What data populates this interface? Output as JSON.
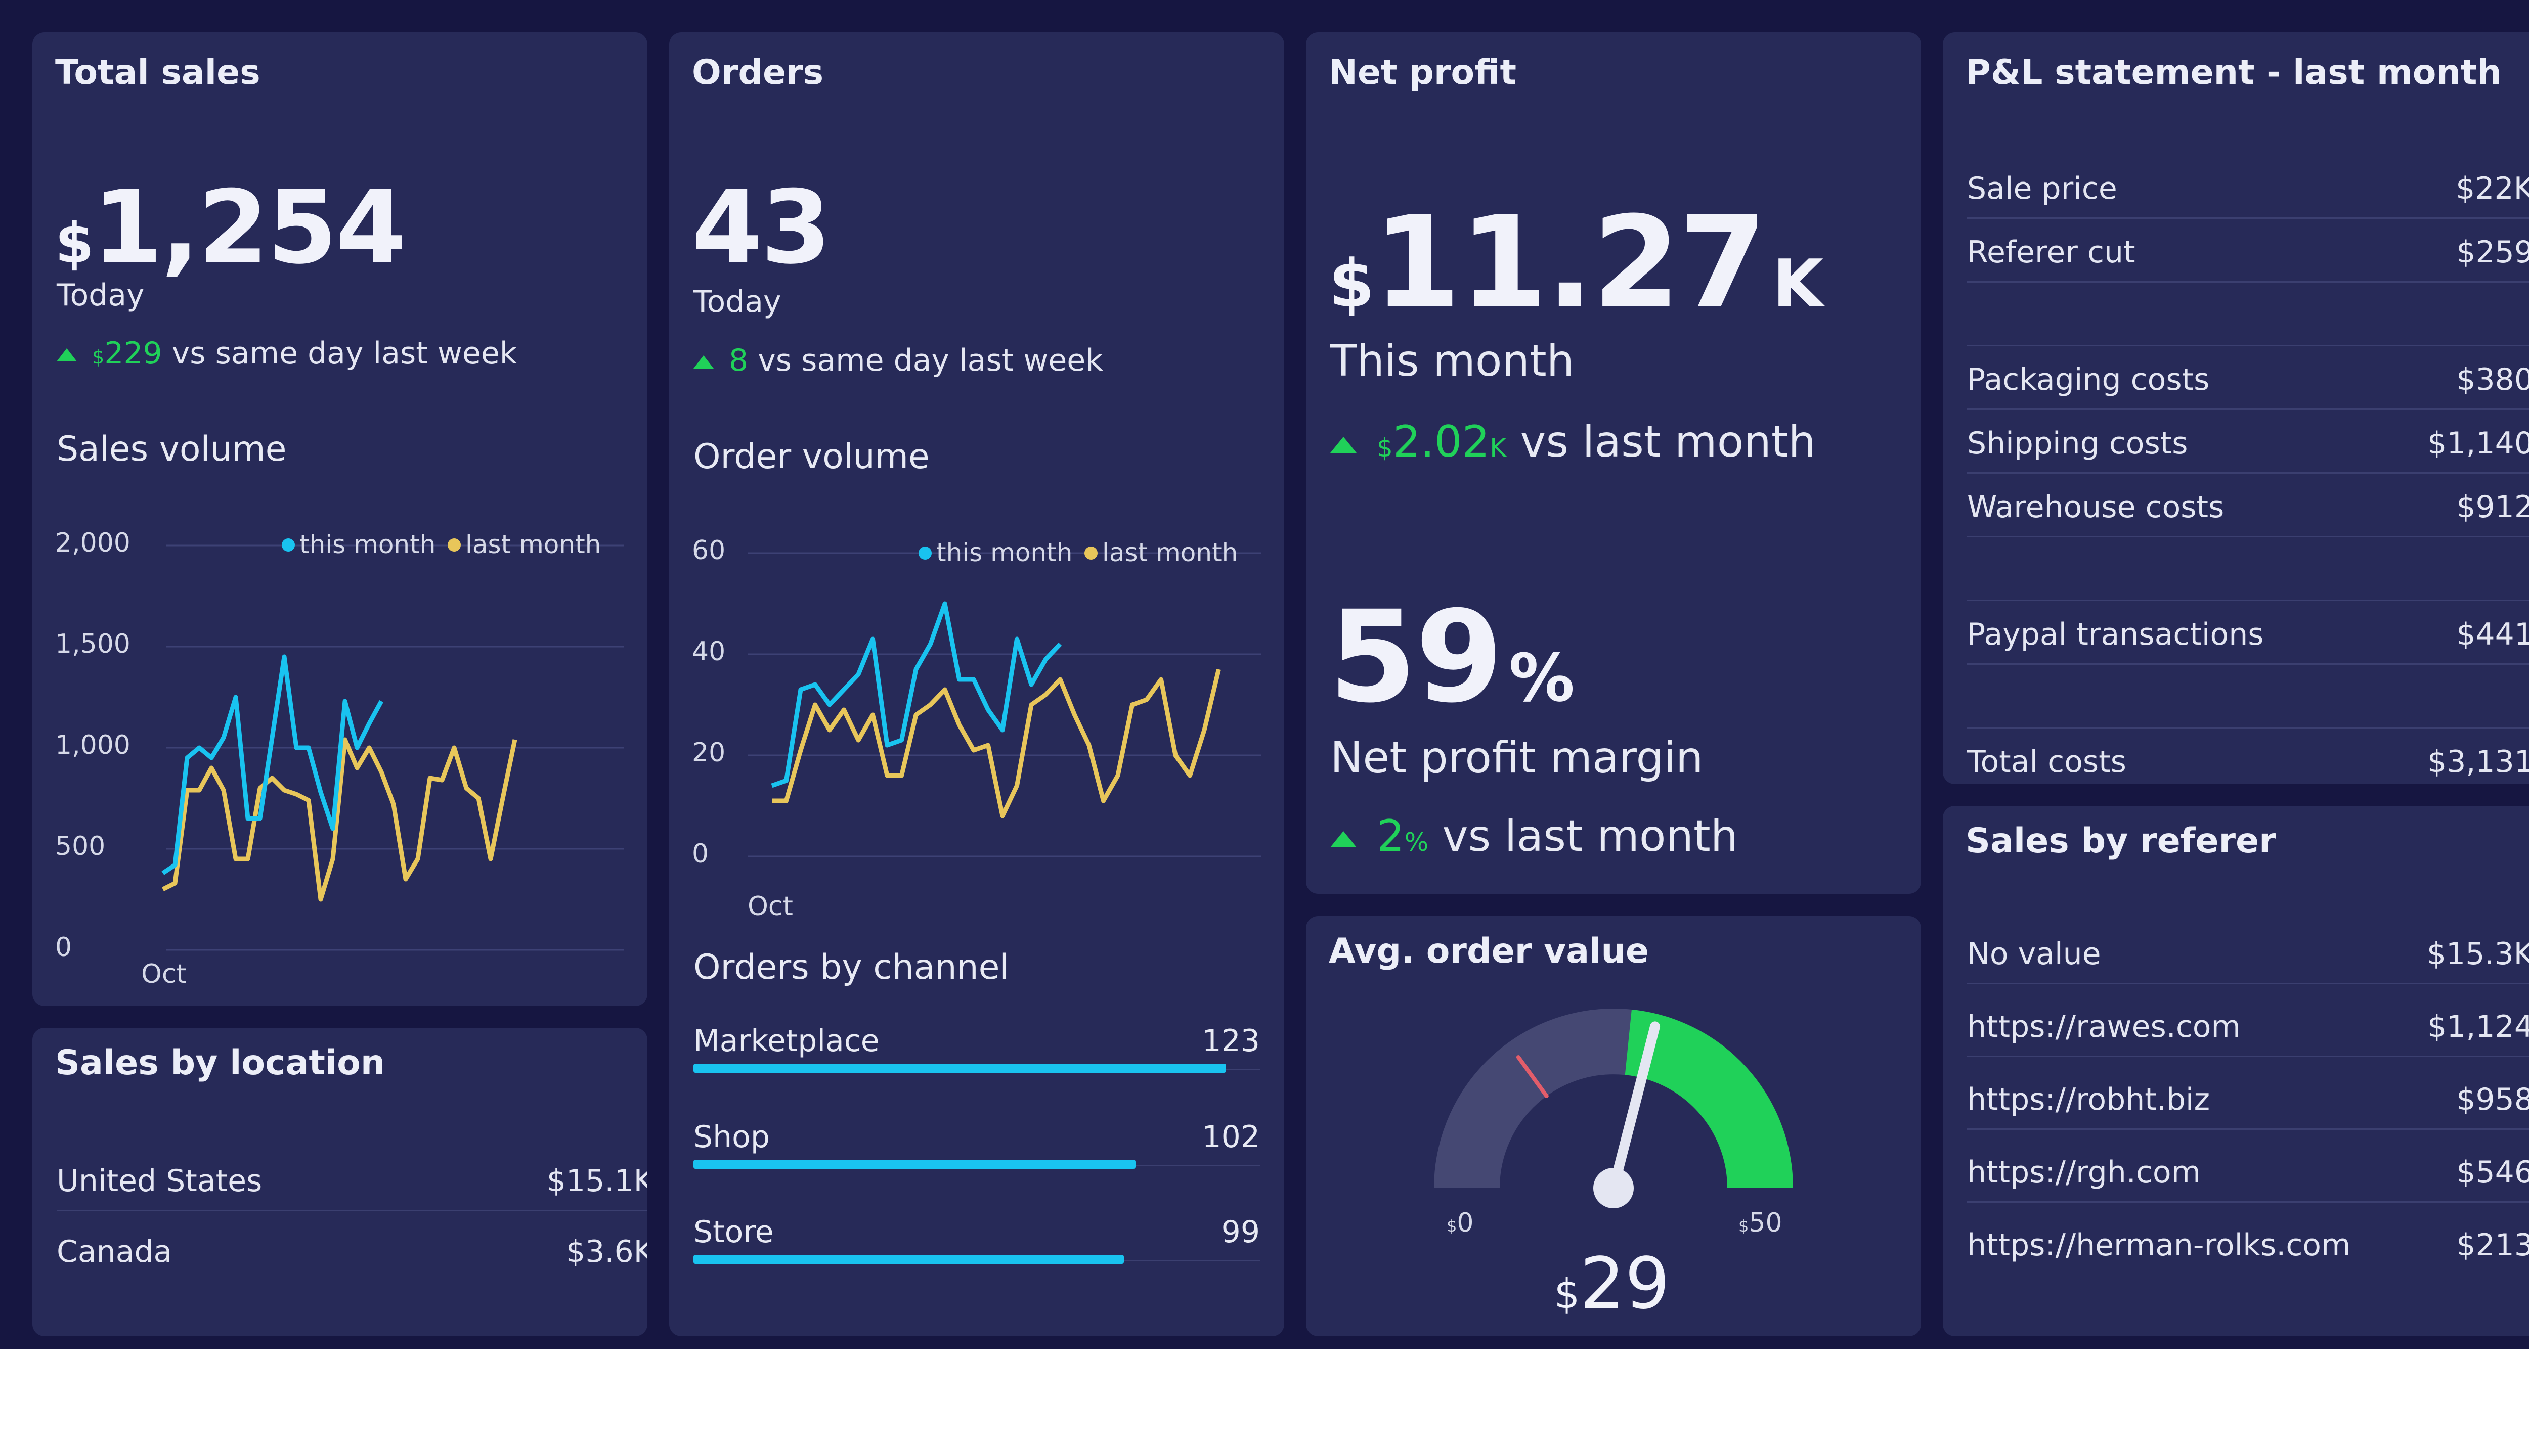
{
  "colors": {
    "background": "#161641",
    "panel": "#272a58",
    "this_month": "#19c3f0",
    "last_month": "#e8c65a",
    "positive": "#20d159",
    "bar": "#19c3f0",
    "gauge_track": "#454873",
    "gauge_needle": "#e4e6f2",
    "gauge_marker": "#e35d6a"
  },
  "total_sales": {
    "title": "Total sales",
    "currency": "$",
    "value": "1,254",
    "period": "Today",
    "change_currency": "$",
    "change_value": "229",
    "change_text": "vs same day last week",
    "chart_title": "Sales volume"
  },
  "orders": {
    "title": "Orders",
    "value": "43",
    "period": "Today",
    "change_value": "8",
    "change_text": "vs same day last week",
    "chart_title": "Order volume",
    "channels_title": "Orders by channel",
    "channels": [
      {
        "name": "Marketplace",
        "value": "123",
        "fraction": 0.94
      },
      {
        "name": "Shop",
        "value": "102",
        "fraction": 0.78
      },
      {
        "name": "Store",
        "value": "99",
        "fraction": 0.76
      }
    ]
  },
  "net_profit": {
    "title": "Net profit",
    "currency": "$",
    "value": "11.27",
    "unit": "K",
    "period": "This month",
    "change_currency": "$",
    "change_value": "2.02",
    "change_unit": "K",
    "change_text": "vs last month",
    "margin_value": "59",
    "margin_unit": "%",
    "margin_label": "Net profit margin",
    "margin_change_value": "2",
    "margin_change_unit": "%",
    "margin_change_text": "vs last month"
  },
  "avg_order": {
    "title": "Avg. order value",
    "min_label": "0",
    "max_label": "50",
    "currency": "$",
    "value": "29"
  },
  "pnl": {
    "title": "P&L statement - last month",
    "rows": [
      {
        "label": "Sale price",
        "value": "$22K"
      },
      {
        "label": "Referer cut",
        "value": "$259"
      },
      {
        "label": "",
        "value": ""
      },
      {
        "label": "Packaging costs",
        "value": "$380"
      },
      {
        "label": "Shipping costs",
        "value": "$1,140"
      },
      {
        "label": "Warehouse costs",
        "value": "$912"
      },
      {
        "label": "",
        "value": ""
      },
      {
        "label": "Paypal transactions",
        "value": "$441"
      },
      {
        "label": "",
        "value": ""
      },
      {
        "label": "Total costs",
        "value": "$3,131"
      }
    ]
  },
  "sales_location": {
    "title": "Sales by location",
    "rows": [
      {
        "label": "United States",
        "value": "$15.1K"
      },
      {
        "label": "Canada",
        "value": "$3.6K"
      }
    ]
  },
  "sales_referer": {
    "title": "Sales by referer",
    "rows": [
      {
        "label": "No value",
        "value": "$15.3K"
      },
      {
        "label": "https://rawes.com",
        "value": "$1,124"
      },
      {
        "label": "https://robht.biz",
        "value": "$958"
      },
      {
        "label": "https://rgh.com",
        "value": "$546"
      },
      {
        "label": "https://herman-rolks.com",
        "value": "$213"
      }
    ]
  },
  "chart_data": [
    {
      "type": "line",
      "title": "Sales volume",
      "x_tick_labels": [
        "Oct"
      ],
      "y_ticks": [
        "2,000",
        "1,500",
        "1,000",
        "500",
        "0"
      ],
      "ylim": [
        0,
        2000
      ],
      "grid": true,
      "legend": "top-right",
      "legend_labels": [
        "this month",
        "last month"
      ],
      "series": [
        {
          "name": "this month",
          "values": [
            380,
            420,
            950,
            1000,
            950,
            1050,
            1250,
            650,
            650,
            1050,
            1450,
            1000,
            1000,
            780,
            600,
            1230,
            1000,
            1120,
            1230
          ]
        },
        {
          "name": "last month",
          "values": [
            300,
            330,
            790,
            790,
            900,
            790,
            450,
            450,
            800,
            850,
            790,
            770,
            740,
            250,
            450,
            1040,
            900,
            1000,
            880,
            720,
            350,
            450,
            850,
            840,
            1000,
            800,
            750,
            450,
            750,
            1040
          ]
        }
      ]
    },
    {
      "type": "line",
      "title": "Order volume",
      "x_tick_labels": [
        "Oct"
      ],
      "y_ticks": [
        "60",
        "40",
        "20",
        "0"
      ],
      "ylim": [
        0,
        60
      ],
      "grid": true,
      "legend": "top-right",
      "legend_labels": [
        "this month",
        "last month"
      ],
      "series": [
        {
          "name": "this month",
          "values": [
            14,
            15,
            33,
            34,
            30,
            33,
            36,
            43,
            22,
            23,
            37,
            42,
            50,
            35,
            35,
            29,
            25,
            43,
            34,
            39,
            42
          ]
        },
        {
          "name": "last month",
          "values": [
            11,
            11,
            21,
            30,
            25,
            29,
            23,
            28,
            16,
            16,
            28,
            30,
            33,
            26,
            21,
            22,
            8,
            14,
            30,
            32,
            35,
            28,
            22,
            11,
            16,
            30,
            31,
            35,
            20,
            16,
            25,
            37
          ]
        }
      ]
    },
    {
      "type": "bar",
      "title": "Orders by channel",
      "categories": [
        "Marketplace",
        "Shop",
        "Store"
      ],
      "values": [
        123,
        102,
        99
      ]
    }
  ]
}
